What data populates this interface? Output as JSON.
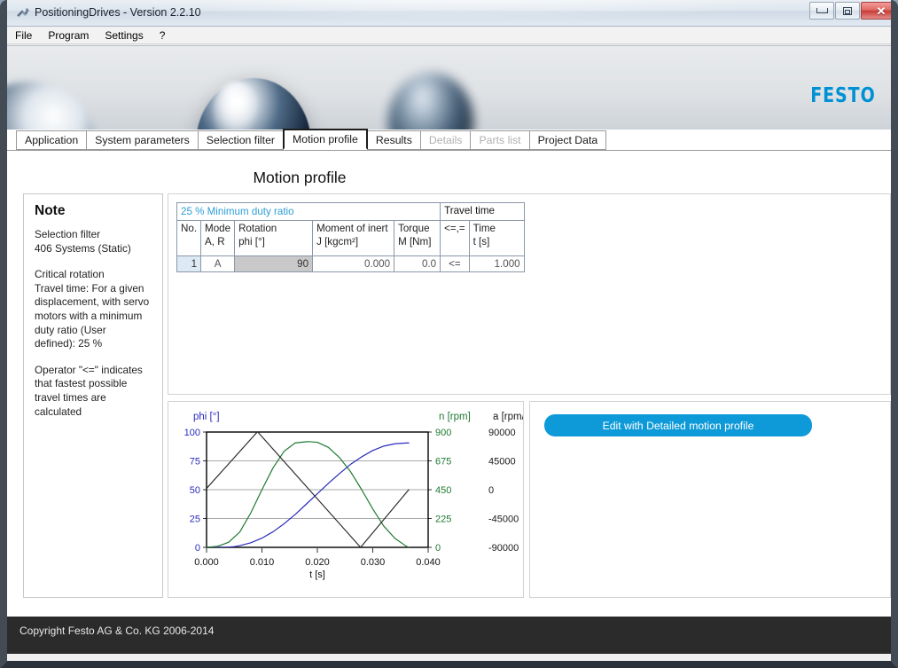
{
  "window": {
    "title": "PositioningDrives - Version 2.2.10",
    "icon": "app-icon",
    "minimize_label": "",
    "maximize_label": "",
    "close_label": "✕"
  },
  "menubar": {
    "items": [
      {
        "label": "File"
      },
      {
        "label": "Program"
      },
      {
        "label": "Settings"
      },
      {
        "label": "?"
      }
    ]
  },
  "banner": {
    "logo_text": "FESTO",
    "logo_color": "#0091d4"
  },
  "tabs": [
    {
      "label": "Application",
      "state": "enabled"
    },
    {
      "label": "System parameters",
      "state": "enabled"
    },
    {
      "label": "Selection filter",
      "state": "enabled"
    },
    {
      "label": "Motion profile",
      "state": "active"
    },
    {
      "label": "Results",
      "state": "enabled"
    },
    {
      "label": "Details",
      "state": "disabled"
    },
    {
      "label": "Parts list",
      "state": "disabled"
    },
    {
      "label": "Project Data",
      "state": "enabled"
    }
  ],
  "page": {
    "title": "Motion profile"
  },
  "note": {
    "heading": "Note",
    "lines": [
      "Selection filter",
      "406 Systems (Static)",
      "",
      "Critical rotation",
      "Travel time: For a given",
      "displacement, with servo",
      "motors with a minimum",
      "duty ratio (User",
      "defined): 25 %",
      "",
      "Operator \"<=\" indicates",
      "that fastest possible",
      "travel times are",
      "calculated"
    ]
  },
  "table": {
    "group_headers": [
      {
        "label": "25 % Minimum duty ratio",
        "accent": "#2f9ed6"
      },
      {
        "label": "Travel time",
        "accent": "#111111"
      }
    ],
    "columns": [
      {
        "line1": "No.",
        "line2": ""
      },
      {
        "line1": "Mode",
        "line2": "A, R"
      },
      {
        "line1": "Rotation",
        "line2": "phi [°]"
      },
      {
        "line1": "Moment of inert",
        "line2": "J [kgcm²]"
      },
      {
        "line1": "Torque",
        "line2": "M [Nm]"
      },
      {
        "line1": "<=,=",
        "line2": ""
      },
      {
        "line1": "Time",
        "line2": "t [s]"
      }
    ],
    "rows": [
      {
        "no": "1",
        "mode": "A",
        "rotation": "90",
        "moment_of_inertia": "0.000",
        "torque": "0.0",
        "operator": "<=",
        "time": "1.000"
      }
    ]
  },
  "action_panel": {
    "button_label": "Edit with Detailed motion profile",
    "button_color": "#0e9ad8"
  },
  "statusbar": {
    "text": "Copyright Festo AG & Co. KG 2006-2014"
  },
  "chart_data": {
    "type": "line",
    "title": "",
    "xlabel": "t [s]",
    "xlim": [
      0.0,
      0.04
    ],
    "xticks": [
      "0.000",
      "0.010",
      "0.020",
      "0.030",
      "0.040"
    ],
    "xtick_values": [
      0.0,
      0.01,
      0.02,
      0.03,
      0.04
    ],
    "grid": true,
    "legend_position": "top",
    "axes": [
      {
        "id": "left",
        "label": "phi [°]",
        "color": "#2b2bbf",
        "ylim": [
          0,
          100
        ],
        "ticks": [
          "0",
          "25",
          "50",
          "75",
          "100"
        ],
        "tick_values": [
          0,
          25,
          50,
          75,
          100
        ]
      },
      {
        "id": "right-inner",
        "label": "n [rpm]",
        "color": "#1f7a33",
        "ylim": [
          0,
          900
        ],
        "ticks": [
          "0",
          "225",
          "450",
          "675",
          "900"
        ],
        "tick_values": [
          0,
          225,
          450,
          675,
          900
        ]
      },
      {
        "id": "right-outer",
        "label": "a [rpm/s]",
        "color": "#1a1a1a",
        "ylim": [
          -90000,
          90000
        ],
        "ticks": [
          "-90000",
          "-45000",
          "0",
          "45000",
          "90000"
        ],
        "tick_values": [
          -90000,
          -45000,
          0,
          45000,
          90000
        ]
      }
    ],
    "series": [
      {
        "name": "phi [°]",
        "axis": "left",
        "color": "#2b2bbf",
        "x": [
          0.0,
          0.002,
          0.004,
          0.005,
          0.006,
          0.008,
          0.01,
          0.012,
          0.014,
          0.016,
          0.018,
          0.02,
          0.022,
          0.024,
          0.026,
          0.028,
          0.03,
          0.032,
          0.034,
          0.036,
          0.0365
        ],
        "y": [
          0.0,
          0.0,
          0.2,
          0.6,
          1.5,
          4.0,
          8.0,
          13.5,
          20.5,
          28.5,
          37.5,
          46.5,
          55.5,
          64.0,
          72.0,
          78.5,
          84.0,
          87.8,
          89.8,
          90.5,
          90.5
        ]
      },
      {
        "name": "n [rpm]",
        "axis": "right-inner",
        "color": "#1f7a33",
        "x": [
          0.0,
          0.002,
          0.004,
          0.006,
          0.008,
          0.01,
          0.012,
          0.014,
          0.016,
          0.018,
          0.0185,
          0.02,
          0.022,
          0.024,
          0.026,
          0.028,
          0.03,
          0.032,
          0.034,
          0.036,
          0.0365
        ],
        "y": [
          0,
          8,
          40,
          120,
          270,
          450,
          620,
          750,
          815,
          824,
          825,
          820,
          780,
          700,
          590,
          450,
          300,
          165,
          70,
          10,
          0
        ]
      },
      {
        "name": "a [rpm/s]",
        "axis": "right-outer",
        "color": "#2e2e2e",
        "x": [
          0.0,
          0.0092,
          0.0278,
          0.0365
        ],
        "y": [
          2000,
          90500,
          -90000,
          0
        ]
      }
    ]
  }
}
